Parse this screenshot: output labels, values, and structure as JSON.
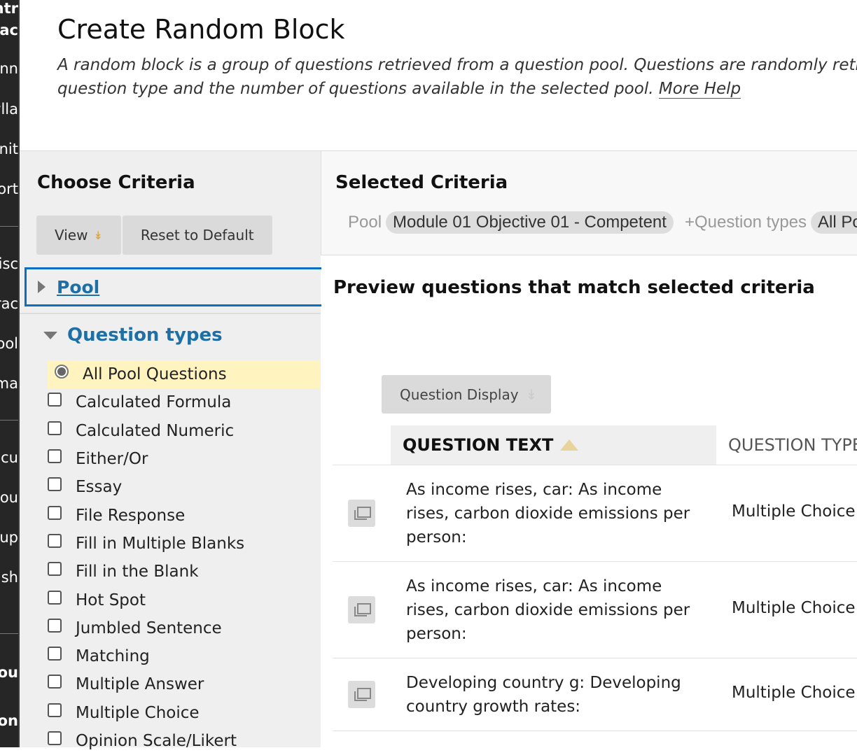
{
  "sidebar": {
    "items": [
      {
        "label": "ntr",
        "bold": true
      },
      {
        "label": "lac",
        "bold": true
      },
      {
        "label": "nn"
      },
      {
        "label": "ylla"
      },
      {
        "label": "nit"
      },
      {
        "label": "ort"
      },
      {
        "label": "isc"
      },
      {
        "label": "rac"
      },
      {
        "label": "ool"
      },
      {
        "label": "ma"
      },
      {
        "label": "acu"
      },
      {
        "label": "ou"
      },
      {
        "label": "up"
      },
      {
        "label": "ash"
      },
      {
        "label": "ou",
        "bold": true
      },
      {
        "label": "on",
        "bold": true
      }
    ]
  },
  "header": {
    "title": "Create Random Block",
    "desc_line1": "A random block is a group of questions retrieved from a question pool. Questions are randomly retrieve",
    "desc_line2": "question type and the number of questions available in the selected pool. ",
    "help_link": "More Help"
  },
  "choose": {
    "title": "Choose Criteria",
    "view_label": "View",
    "reset_label": "Reset to Default",
    "pool_label": "Pool",
    "qtypes_label": "Question types",
    "question_types": [
      {
        "label": "All Pool Questions",
        "selected": true
      },
      {
        "label": "Calculated Formula"
      },
      {
        "label": "Calculated Numeric"
      },
      {
        "label": "Either/Or"
      },
      {
        "label": "Essay"
      },
      {
        "label": "File Response"
      },
      {
        "label": "Fill in Multiple Blanks"
      },
      {
        "label": "Fill in the Blank"
      },
      {
        "label": "Hot Spot"
      },
      {
        "label": "Jumbled Sentence"
      },
      {
        "label": "Matching"
      },
      {
        "label": "Multiple Answer"
      },
      {
        "label": "Multiple Choice"
      },
      {
        "label": "Opinion Scale/Likert"
      }
    ]
  },
  "selected": {
    "title": "Selected Criteria",
    "pool_label": "Pool",
    "pool_value": "Module 01 Objective 01 - Competent",
    "plus": "+",
    "qtypes_label": "Question types",
    "qtypes_value": "All Poo"
  },
  "preview": {
    "title": "Preview questions that match selected criteria",
    "display_label": "Question Display",
    "col_text": "QUESTION TEXT",
    "col_type": "QUESTION TYPE",
    "rows": [
      {
        "text": "As income rises, car: As income rises, carbon dioxide emissions per person:",
        "type": "Multiple Choice"
      },
      {
        "text": "As income rises, car: As income rises, carbon dioxide emissions per person:",
        "type": "Multiple Choice"
      },
      {
        "text": "Developing country g: Developing country growth rates:",
        "type": "Multiple Choice"
      }
    ]
  },
  "colors": {
    "link": "#1d6fa5",
    "focus": "#0a6fc2",
    "selected_row": "#fff3c0",
    "sidebar": "#262626"
  }
}
